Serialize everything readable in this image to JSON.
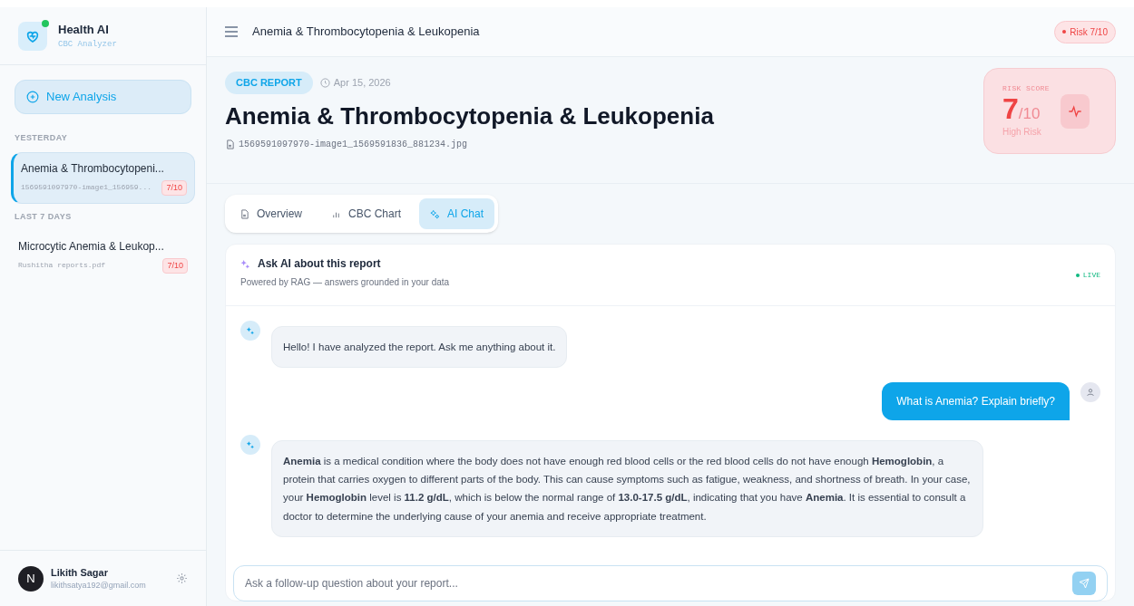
{
  "brand": {
    "name": "Health AI",
    "subtitle": "CBC Analyzer",
    "online": true
  },
  "new_analysis": "New Analysis",
  "history": [
    {
      "section": "YESTERDAY",
      "items": [
        {
          "title": "Anemia & Thrombocytopeni...",
          "file": "1569591097970-image1_156959...",
          "risk": "7/10",
          "selected": true
        }
      ]
    },
    {
      "section": "LAST 7 DAYS",
      "items": [
        {
          "title": "Microcytic Anemia & Leukop...",
          "file": "Rushitha reports.pdf",
          "risk": "7/10",
          "selected": false
        }
      ]
    }
  ],
  "user": {
    "initial": "N",
    "name": "Likith Sagar",
    "email": "likithsatya192@gmail.com"
  },
  "top_bar": {
    "title": "Anemia & Thrombocytopenia & Leukopenia",
    "risk_badge": "Risk 7/10"
  },
  "report": {
    "tag": "CBC REPORT",
    "date": "Apr 15, 2026",
    "title": "Anemia & Thrombocytopenia & Leukopenia",
    "file": "1569591097970-image1_1569591836_881234.jpg"
  },
  "risk_card": {
    "label": "RISK SCORE",
    "score": "7",
    "max": "/10",
    "level_text": "High Risk"
  },
  "tabs": [
    {
      "label": "Overview",
      "kind": "doc",
      "selected": false
    },
    {
      "label": "CBC Chart",
      "kind": "bars",
      "selected": false
    },
    {
      "label": "AI Chat",
      "kind": "sparkle",
      "selected": true
    }
  ],
  "chat": {
    "title": "Ask AI about this report",
    "subtitle": "Powered by RAG — answers grounded in your data",
    "status": "LIVE",
    "messages": [
      {
        "kind": "assistant",
        "text": "Hello! I have analyzed the report. Ask me anything about it."
      },
      {
        "kind": "user",
        "text": "What is Anemia? Explain briefly?"
      },
      {
        "kind": "assistant",
        "text": "**Anemia** is a medical condition where the body does not have enough red blood cells or the red blood cells do not have enough **Hemoglobin**, a protein that carries oxygen to different parts of the body. This can cause symptoms such as fatigue, weakness, and shortness of breath. In your case, your **Hemoglobin** level is **11.2 g/dL**, which is below the normal range of **13.0-17.5 g/dL**, indicating that you have **Anemia**. It is essential to consult a doctor to determine the underlying cause of your anemia and receive appropriate treatment."
      }
    ],
    "input_placeholder": "Ask a follow-up question about your report..."
  }
}
